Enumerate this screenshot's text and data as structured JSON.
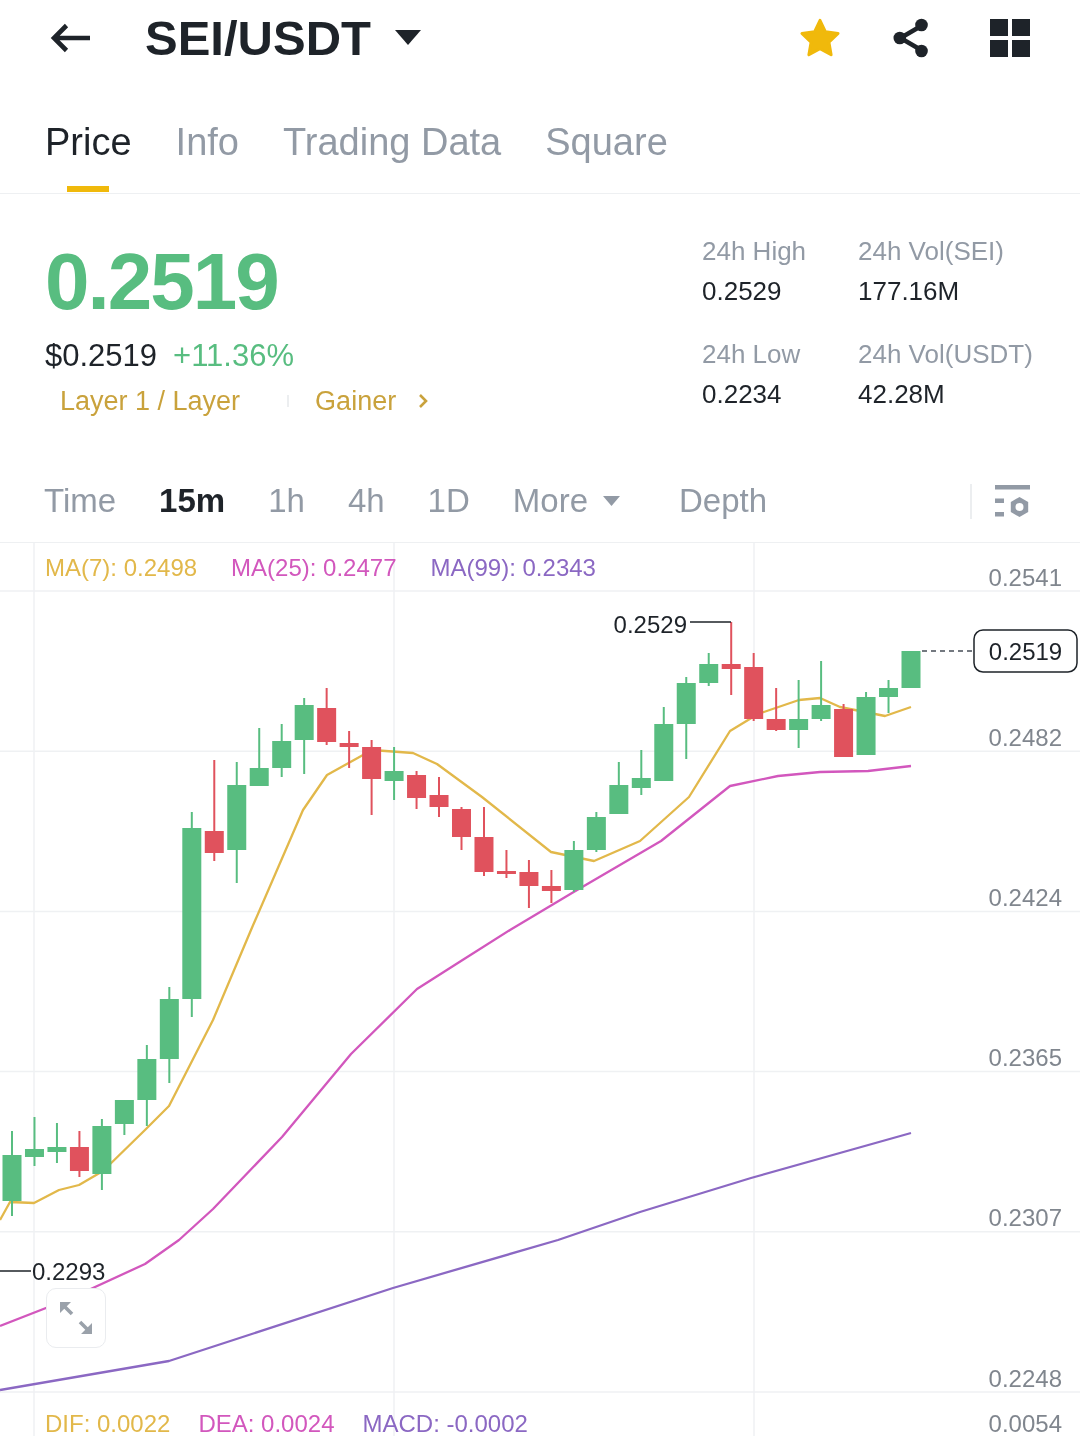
{
  "header": {
    "title": "SEI/USDT",
    "favorite": true
  },
  "tabs": [
    {
      "label": "Price",
      "selected": true
    },
    {
      "label": "Info",
      "selected": false
    },
    {
      "label": "Trading Data",
      "selected": false
    },
    {
      "label": "Square",
      "selected": false
    }
  ],
  "ticker": {
    "price": "0.2519",
    "usd_price": "$0.2519",
    "change": "+11.36%",
    "rising": true,
    "tags": [
      "Layer 1 / Layer",
      "Gainer"
    ]
  },
  "stats": [
    {
      "label": "24h High",
      "value": "0.2529"
    },
    {
      "label": "24h Vol(SEI)",
      "value": "177.16M"
    },
    {
      "label": "24h Low",
      "value": "0.2234"
    },
    {
      "label": "24h Vol(USDT)",
      "value": "42.28M"
    }
  ],
  "intervals": [
    {
      "label": "Time",
      "kind": "option",
      "selected": false
    },
    {
      "label": "15m",
      "kind": "option",
      "selected": true
    },
    {
      "label": "1h",
      "kind": "option",
      "selected": false
    },
    {
      "label": "4h",
      "kind": "option",
      "selected": false
    },
    {
      "label": "1D",
      "kind": "option",
      "selected": false
    },
    {
      "label": "More",
      "kind": "menu",
      "selected": false
    },
    {
      "label": "Depth",
      "kind": "option",
      "selected": false
    }
  ],
  "chart": {
    "ma_legend": [
      {
        "label": "MA(7): 0.2498",
        "color": "#e2b84a"
      },
      {
        "label": "MA(25): 0.2477",
        "color": "#d257bd"
      },
      {
        "label": "MA(99): 0.2343",
        "color": "#8b68c3"
      }
    ],
    "price_axis": [
      "0.2541",
      "0.2482",
      "0.2424",
      "0.2365",
      "0.2307",
      "0.2248"
    ],
    "high_marker": "0.2529",
    "low_marker": "0.2293",
    "last_price": "0.2519",
    "macd_legend": [
      {
        "label": "DIF: 0.0022",
        "color": "#e2b84a"
      },
      {
        "label": "DEA: 0.0024",
        "color": "#d257bd"
      },
      {
        "label": "MACD: -0.0002",
        "color": "#8b68c3"
      }
    ],
    "macd_axis": "0.0054"
  }
}
